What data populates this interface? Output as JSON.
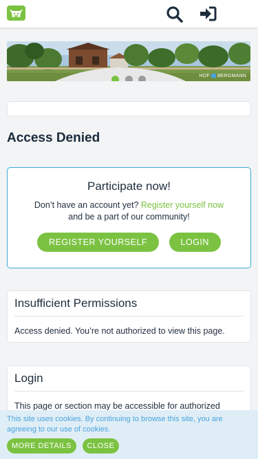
{
  "header": {
    "logo_icon": "cow-head-icon",
    "search_icon": "search-icon",
    "login_icon": "sign-in-icon",
    "brand_color": "#7cc242"
  },
  "banner": {
    "brand_text_left": "HOF",
    "brand_text_right": "BERGMANN",
    "slides": 3,
    "active_slide": 1
  },
  "page": {
    "title": "Access Denied"
  },
  "participate": {
    "heading": "Participate now!",
    "text_before_link": "Don’t have an account yet? ",
    "link_text": "Register yourself now",
    "text_after_link": "and be a part of our community!",
    "register_button": "REGISTER YOURSELF",
    "login_button": "LOGIN",
    "border_color": "#3aa9d6"
  },
  "permissions_card": {
    "title": "Insufficient Permissions",
    "message": "Access denied. You’re not authorized to view this page."
  },
  "login_card": {
    "title": "Login",
    "message": "This page or section may be accessible for authorized"
  },
  "cookie_bar": {
    "message": "This site uses cookies. By continuing to browse this site, you are agreeing to our use of cookies.",
    "more_details_button": "MORE DETAILS",
    "close_button": "CLOSE",
    "text_color": "#4aa3df"
  }
}
